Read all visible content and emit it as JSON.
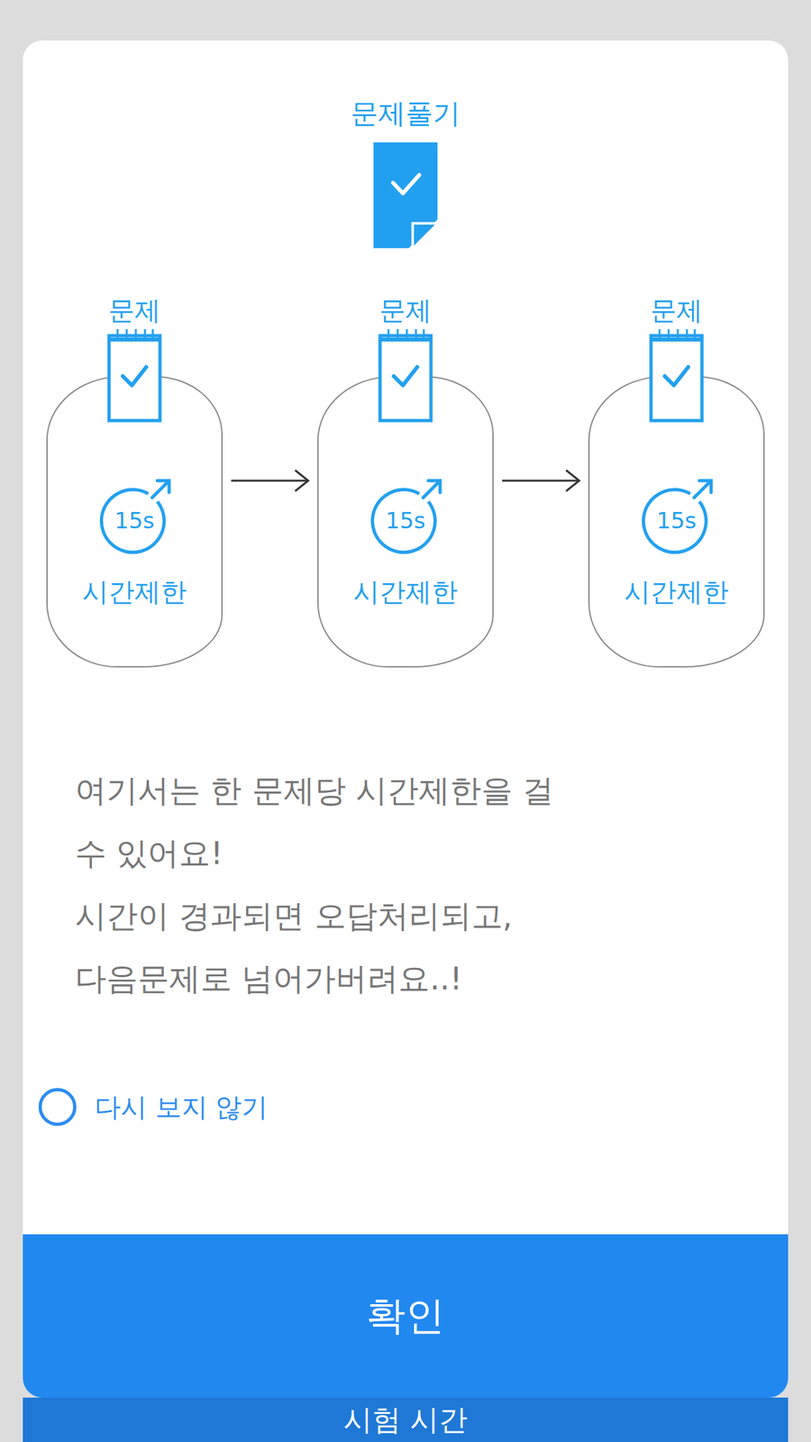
{
  "dialog": {
    "diagram": {
      "title": "문제풀기",
      "steps": [
        {
          "label": "문제",
          "timer": "15s",
          "caption": "시간제한"
        },
        {
          "label": "문제",
          "timer": "15s",
          "caption": "시간제한"
        },
        {
          "label": "문제",
          "timer": "15s",
          "caption": "시간제한"
        }
      ]
    },
    "message": [
      "여기서는 한 문제당 시간제한을 걸",
      "수 있어요!",
      "시간이 경과되면 오답처리되고,",
      "다음문제로 넘어가버려요..!"
    ],
    "dont_show_again": {
      "label": "다시 보지 않기",
      "checked": false
    },
    "confirm_button": "확인"
  },
  "bottom_button": "시험 시간"
}
